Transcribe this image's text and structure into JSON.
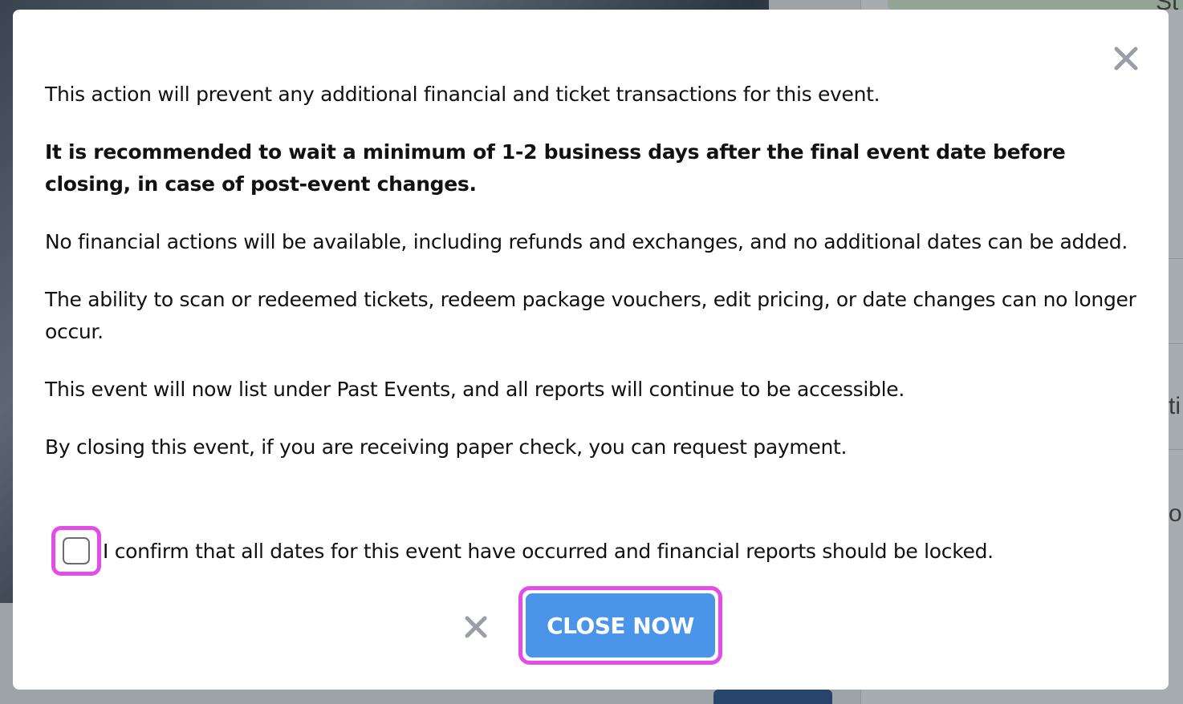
{
  "modal": {
    "paragraphs": [
      "This action will prevent any additional financial and ticket transactions for this event.",
      "It is recommended to wait a minimum of 1-2 business days after the final event date before closing, in case of post-event changes.",
      "No financial actions will be available, including refunds and exchanges, and no additional dates can be added.",
      "The ability to scan or redeemed tickets, redeem package vouchers, edit pricing, or date changes can no longer occur.",
      "This event will now list under Past Events, and all reports will continue to be accessible.",
      "By closing this event, if you are receiving paper check, you can request payment."
    ],
    "confirm_label": "I confirm that all dates for this event have occurred and financial reports should be locked.",
    "confirm_checked": false,
    "close_now_label": "CLOSE NOW",
    "close_icon": "close-icon",
    "cancel_icon": "cancel-icon"
  },
  "background": {
    "fragments": [
      "St",
      "ti",
      "o"
    ]
  },
  "colors": {
    "highlight": "#e34ce6",
    "primary_button": "#4a95ea",
    "icon_gray": "#9a9ea6",
    "text": "#111111"
  }
}
